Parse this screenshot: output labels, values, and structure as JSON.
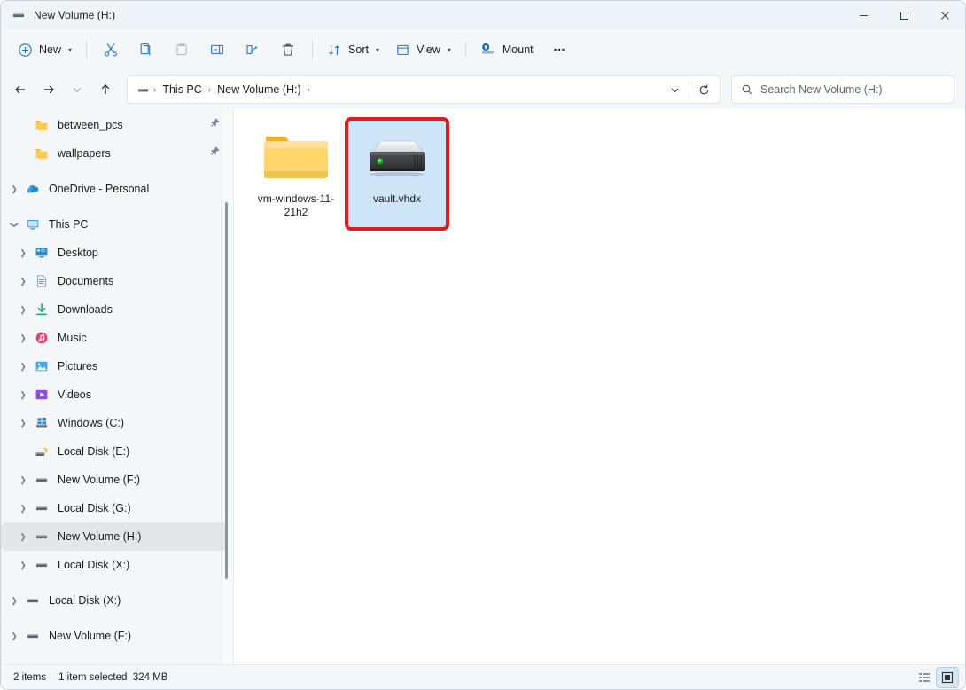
{
  "window": {
    "title": "New Volume (H:)",
    "title_icon": "drive-icon",
    "controls": {
      "minimize": "─",
      "maximize": "□",
      "close": "✕"
    }
  },
  "toolbar": {
    "new_label": "New",
    "cut_label": "Cut",
    "copy_label": "Copy",
    "paste_label": "Paste",
    "rename_label": "Rename",
    "share_label": "Share",
    "delete_label": "Delete",
    "sort_label": "Sort",
    "view_label": "View",
    "mount_label": "Mount",
    "more_label": "See more"
  },
  "navbar": {
    "back_label": "Back",
    "forward_label": "Forward",
    "recent_label": "Recent locations",
    "up_label": "Up to This PC",
    "refresh_label": "Refresh",
    "breadcrumbs": [
      "This PC",
      "New Volume (H:)"
    ],
    "separator": "›"
  },
  "search": {
    "placeholder": "Search New Volume (H:)",
    "value": ""
  },
  "sidebar": {
    "items": [
      {
        "label": "between_pcs",
        "icon": "folder-icon",
        "indent": 1,
        "expander": "",
        "pinned": true,
        "selected": false
      },
      {
        "label": "wallpapers",
        "icon": "folder-icon",
        "indent": 1,
        "expander": "",
        "pinned": true,
        "selected": false
      },
      {
        "label": "OneDrive - Personal",
        "icon": "onedrive-icon",
        "indent": 0,
        "expander": "›",
        "pinned": false,
        "selected": false
      },
      {
        "label": "This PC",
        "icon": "thispc-icon",
        "indent": 0,
        "expander": "⌄",
        "pinned": false,
        "selected": false
      },
      {
        "label": "Desktop",
        "icon": "desktop-icon",
        "indent": 1,
        "expander": "›",
        "pinned": false,
        "selected": false
      },
      {
        "label": "Documents",
        "icon": "documents-icon",
        "indent": 1,
        "expander": "›",
        "pinned": false,
        "selected": false
      },
      {
        "label": "Downloads",
        "icon": "downloads-icon",
        "indent": 1,
        "expander": "›",
        "pinned": false,
        "selected": false
      },
      {
        "label": "Music",
        "icon": "music-icon",
        "indent": 1,
        "expander": "›",
        "pinned": false,
        "selected": false
      },
      {
        "label": "Pictures",
        "icon": "pictures-icon",
        "indent": 1,
        "expander": "›",
        "pinned": false,
        "selected": false
      },
      {
        "label": "Videos",
        "icon": "videos-icon",
        "indent": 1,
        "expander": "›",
        "pinned": false,
        "selected": false
      },
      {
        "label": "Windows (C:)",
        "icon": "windows-drive-icon",
        "indent": 1,
        "expander": "›",
        "pinned": false,
        "selected": false
      },
      {
        "label": "Local Disk (E:)",
        "icon": "usb-drive-icon",
        "indent": 1,
        "expander": "",
        "pinned": false,
        "selected": false
      },
      {
        "label": "New Volume (F:)",
        "icon": "drive-icon",
        "indent": 1,
        "expander": "›",
        "pinned": false,
        "selected": false
      },
      {
        "label": "Local Disk (G:)",
        "icon": "drive-icon",
        "indent": 1,
        "expander": "›",
        "pinned": false,
        "selected": false
      },
      {
        "label": "New Volume (H:)",
        "icon": "drive-icon",
        "indent": 1,
        "expander": "›",
        "pinned": false,
        "selected": true
      },
      {
        "label": "Local Disk (X:)",
        "icon": "drive-icon",
        "indent": 1,
        "expander": "›",
        "pinned": false,
        "selected": false
      },
      {
        "label": "Local Disk (X:)",
        "icon": "drive-icon",
        "indent": 0,
        "expander": "›",
        "pinned": false,
        "selected": false
      },
      {
        "label": "New Volume (F:)",
        "icon": "drive-icon",
        "indent": 0,
        "expander": "›",
        "pinned": false,
        "selected": false
      }
    ]
  },
  "files": [
    {
      "name": "vm-windows-11-21h2",
      "icon": "folder-icon",
      "selected": false
    },
    {
      "name": "vault.vhdx",
      "icon": "vhdx-disk-icon",
      "selected": true
    }
  ],
  "status": {
    "item_count": "2 items",
    "selection": "1 item selected",
    "size": "324 MB",
    "details_view_label": "Details view",
    "large_icons_view_label": "Large icons view"
  },
  "colors": {
    "accent": "#0078d4",
    "selection_fill": "#cee4f7",
    "highlight_border": "#e01b1b",
    "chrome": "#f3f7fa",
    "titlebar": "#eef4f8"
  }
}
